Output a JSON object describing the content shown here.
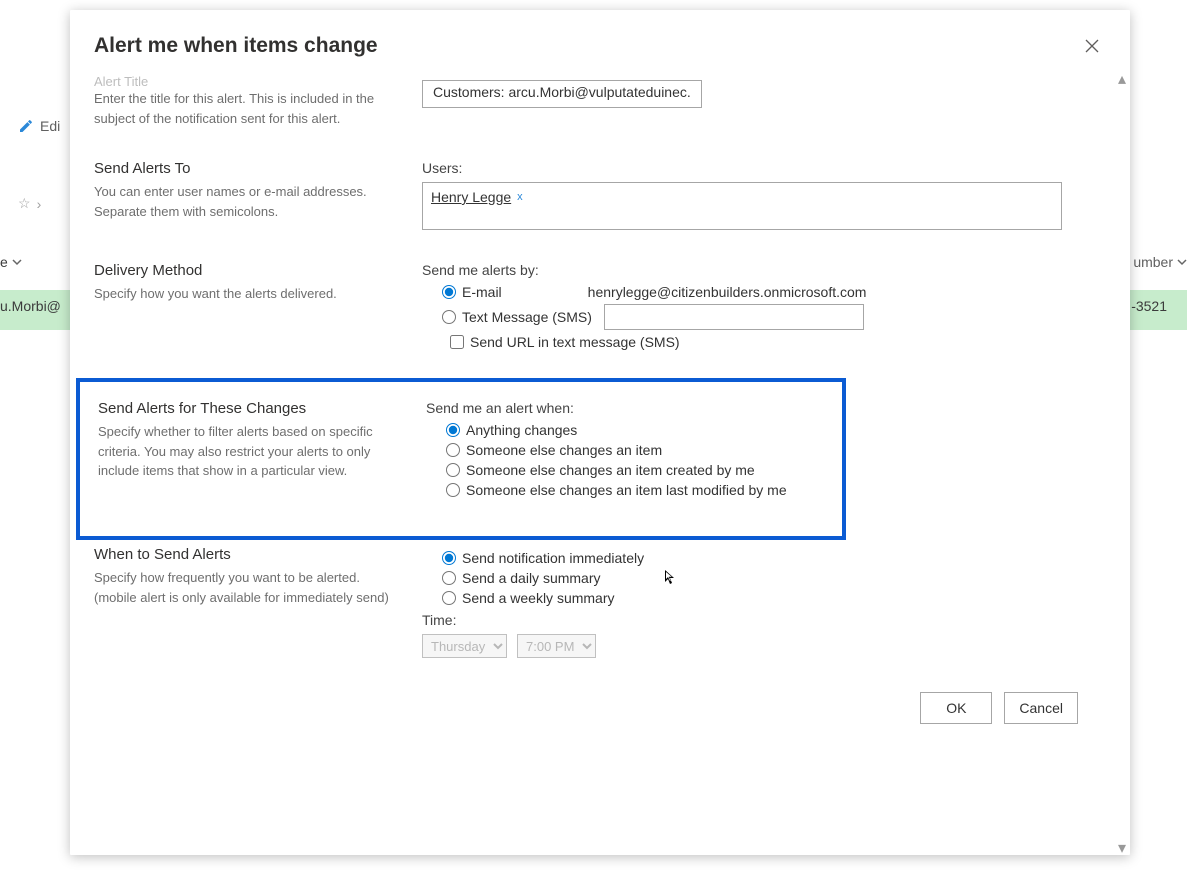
{
  "background": {
    "edit_label": "Edi",
    "e_dropdown": "e",
    "number_col": "umber",
    "row_left": "u.Morbi@",
    "row_right": "-3521"
  },
  "dialog": {
    "title": "Alert me when items change",
    "close_aria": "Close"
  },
  "alert_title": {
    "header_cutoff": "Alert Title",
    "desc": "Enter the title for this alert. This is included in the subject of the notification sent for this alert.",
    "value": "Customers: arcu.Morbi@vulputateduinec."
  },
  "send_to": {
    "header": "Send Alerts To",
    "desc": "You can enter user names or e-mail addresses. Separate them with semicolons.",
    "users_label": "Users:",
    "chip_name": "Henry Legge",
    "chip_remove": "x"
  },
  "delivery": {
    "header": "Delivery Method",
    "desc": "Specify how you want the alerts delivered.",
    "label": "Send me alerts by:",
    "email_label": "E-mail",
    "email_value": "henrylegge@citizenbuilders.onmicrosoft.com",
    "sms_label": "Text Message (SMS)",
    "url_check_label": "Send URL in text message (SMS)"
  },
  "change_type": {
    "header": "Send Alerts for These Changes",
    "desc": "Specify whether to filter alerts based on specific criteria. You may also restrict your alerts to only include items that show in a particular view.",
    "label": "Send me an alert when:",
    "opts": {
      "any": "Anything changes",
      "other": "Someone else changes an item",
      "mine_created": "Someone else changes an item created by me",
      "mine_modified": "Someone else changes an item last modified by me"
    }
  },
  "when": {
    "header": "When to Send Alerts",
    "desc": "Specify how frequently you want to be alerted. (mobile alert is only available for immediately send)",
    "opts": {
      "immediate": "Send notification immediately",
      "daily": "Send a daily summary",
      "weekly": "Send a weekly summary"
    },
    "time_label": "Time:",
    "day": "Thursday",
    "hour": "7:00 PM"
  },
  "footer": {
    "ok": "OK",
    "cancel": "Cancel"
  }
}
